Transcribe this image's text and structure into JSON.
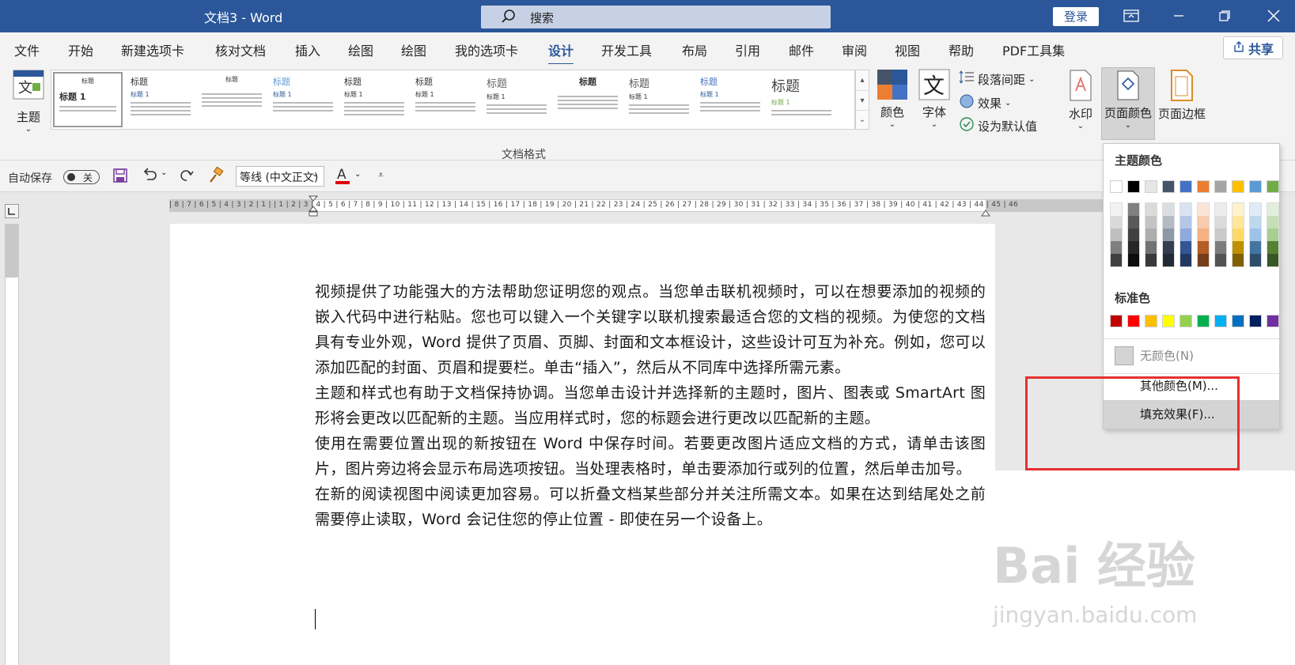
{
  "titlebar": {
    "doc_title": "文档3  -  Word",
    "search_placeholder": "搜索",
    "login_label": "登录"
  },
  "menu": {
    "tabs": [
      "文件",
      "开始",
      "新建选项卡",
      "核对文档",
      "插入",
      "绘图",
      "绘图",
      "我的选项卡",
      "设计",
      "开发工具",
      "布局",
      "引用",
      "邮件",
      "审阅",
      "视图",
      "帮助",
      "PDF工具集"
    ],
    "active_tab": "设计",
    "share_label": "共享"
  },
  "ribbon": {
    "theme_label": "主题",
    "gallery_group_label": "文档格式",
    "thumb_title": "标题",
    "thumb_heading": "标题 1",
    "colors_label": "颜色",
    "fonts_label": "字体",
    "paragraph_spacing_label": "段落间距",
    "effects_label": "效果",
    "set_default_label": "设为默认值",
    "watermark_label": "水印",
    "page_color_label": "页面颜色",
    "page_border_label": "页面边框"
  },
  "qat": {
    "autosave_label": "自动保存",
    "toggle_state": "关",
    "font_name": "等线 (中文正文)"
  },
  "ruler": {
    "ticks": "| 8 | 7 | 6 | 5 | 4 | 3 | 2 | 1 |   | 1 | 2 | 3 | 4 | 5 | 6 | 7 | 8 | 9 | 10 | 11 | 12 | 13 | 14 | 15 | 16 | 17 | 18 | 19 | 20 | 21 | 22 | 23 | 24 | 25 | 26 | 27 | 28 | 29 | 30 | 31 | 32 | 33 | 34 | 35 | 36 | 37 | 38 | 39 | 40 | 41 | 42 | 43 | 44 | 45 | 46"
  },
  "document": {
    "p1": "视频提供了功能强大的方法帮助您证明您的观点。当您单击联机视频时，可以在想要添加的视频的嵌入代码中进行粘贴。您也可以键入一个关键字以联机搜索最适合您的文档的视频。为使您的文档具有专业外观，Word 提供了页眉、页脚、封面和文本框设计，这些设计可互为补充。例如，您可以添加匹配的封面、页眉和提要栏。单击“插入”，然后从不同库中选择所需元素。",
    "p2": "主题和样式也有助于文档保持协调。当您单击设计并选择新的主题时，图片、图表或 SmartArt 图形将会更改以匹配新的主题。当应用样式时，您的标题会进行更改以匹配新的主题。",
    "p3": "使用在需要位置出现的新按钮在 Word 中保存时间。若要更改图片适应文档的方式，请单击该图片，图片旁边将会显示布局选项按钮。当处理表格时，单击要添加行或列的位置，然后单击加号。",
    "p4": "在新的阅读视图中阅读更加容易。可以折叠文档某些部分并关注所需文本。如果在达到结尾处之前需要停止读取，Word 会记住您的停止位置 - 即使在另一个设备上。"
  },
  "dropdown": {
    "theme_colors_header": "主题颜色",
    "standard_colors_header": "标准色",
    "no_color_label": "无颜色(N)",
    "more_colors_label": "其他颜色(M)...",
    "fill_effects_label": "填充效果(F)...",
    "theme_colors": [
      "#ffffff",
      "#000000",
      "#e7e6e6",
      "#44546a",
      "#4472c4",
      "#ed7d31",
      "#a5a5a5",
      "#ffc000",
      "#5b9bd5",
      "#70ad47"
    ],
    "standard_colors": [
      "#c00000",
      "#ff0000",
      "#ffc000",
      "#ffff00",
      "#92d050",
      "#00b050",
      "#00b0f0",
      "#0070c0",
      "#002060",
      "#7030a0"
    ]
  },
  "watermark": {
    "brand": "Bai 经验",
    "url": "jingyan.baidu.com"
  },
  "colors": {
    "accent": "#2b579a",
    "highlight": "#e53030"
  }
}
